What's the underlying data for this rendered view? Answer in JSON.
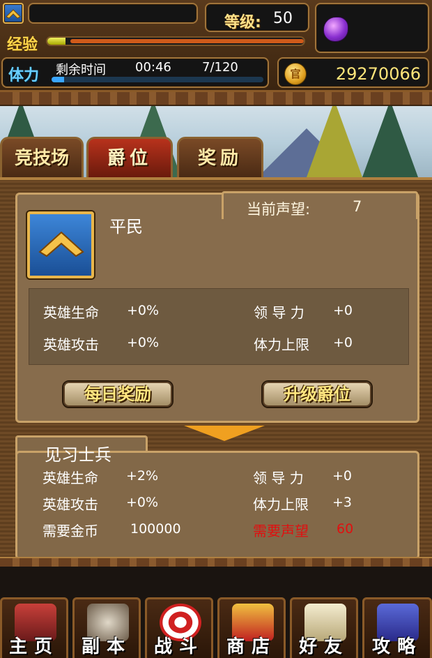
{
  "hud": {
    "level_label": "等级",
    "level_sep": ":",
    "level_value": "50",
    "exp_label": "经验",
    "exp_fraction": 0.07,
    "stamina_label": "体力",
    "remaining_time_label": "剩余时间",
    "remaining_time": "00:46",
    "stamina_value": "7/120",
    "stamina_fraction": 0.06,
    "coin_glyph": "官",
    "gold": "29270066"
  },
  "tabs": [
    {
      "label": "竞技场",
      "active": false
    },
    {
      "label": "爵位",
      "active": true
    },
    {
      "label": "奖励",
      "active": false
    }
  ],
  "current": {
    "rank_name": "平民",
    "reputation_label": "当前声望:",
    "reputation_value": "7",
    "stats": [
      {
        "label": "英雄生命",
        "value": "+0%"
      },
      {
        "label": "英雄攻击",
        "value": "+0%"
      },
      {
        "label": "领 导 力",
        "value": "+0"
      },
      {
        "label": "体力上限",
        "value": "+0"
      }
    ],
    "daily_reward_button": "每日奖励",
    "upgrade_button": "升级爵位"
  },
  "next": {
    "rank_name": "见习士兵",
    "stats": [
      {
        "label": "英雄生命",
        "value": "+2%"
      },
      {
        "label": "英雄攻击",
        "value": "+0%"
      },
      {
        "label": "需要金币",
        "value": "100000"
      },
      {
        "label": "领 导 力",
        "value": "+0"
      },
      {
        "label": "体力上限",
        "value": "+3"
      },
      {
        "label": "需要声望",
        "value": "60"
      }
    ]
  },
  "nav": [
    {
      "label": "主页",
      "icon": "house-icon"
    },
    {
      "label": "副本",
      "icon": "skull-icon"
    },
    {
      "label": "战斗",
      "icon": "target-icon"
    },
    {
      "label": "商店",
      "icon": "merchant-icon"
    },
    {
      "label": "好友",
      "icon": "wings-icon"
    },
    {
      "label": "攻略",
      "icon": "wizard-hat-icon"
    }
  ],
  "colors": {
    "active_tab": "#b8321c",
    "warning_red": "#e01010",
    "gold_text": "#ffe57a"
  }
}
